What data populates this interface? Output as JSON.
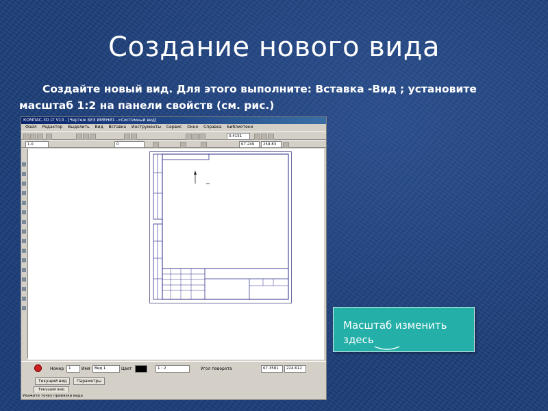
{
  "slide": {
    "title": "Создание нового вида",
    "body": "Создайте новый вид. Для этого выполните: Вставка -Вид ; установите масштаб 1:2 на панели свойств (см. рис.)"
  },
  "app": {
    "window_title": "КОМПАС-3D LT V10 - [Чертеж БЕЗ ИМЕНИ1 ->Системный вид]",
    "menu": [
      "Файл",
      "Редактор",
      "Выделить",
      "Вид",
      "Вставка",
      "Инструменты",
      "Сервис",
      "Окно",
      "Справка",
      "Библиотеки"
    ],
    "toolbar": {
      "zoom_value": "0.4151",
      "coord_x": "67.249",
      "coord_y": "259.83",
      "scale_value": "1.0",
      "layer_value": "0"
    },
    "propbar": {
      "number_label": "Номер",
      "number_value": "1",
      "name_label": "Имя",
      "name_value": "Вид 1",
      "color_label": "Цвет",
      "scale_value": "1 : 2",
      "angle_label": "Угол поворота",
      "x_value": "67.3581",
      "y_value": "224.612"
    },
    "tabs": [
      "Текущий вид",
      "Параметры"
    ],
    "document_tab": "Текущий вид",
    "status_text": "Укажите точку привязки вида"
  },
  "callout": {
    "text": "Масштаб изменить здесь"
  },
  "colors": {
    "background": "#1d3f7a",
    "callout": "#24b0a8",
    "title_bar": "#0a246a"
  }
}
